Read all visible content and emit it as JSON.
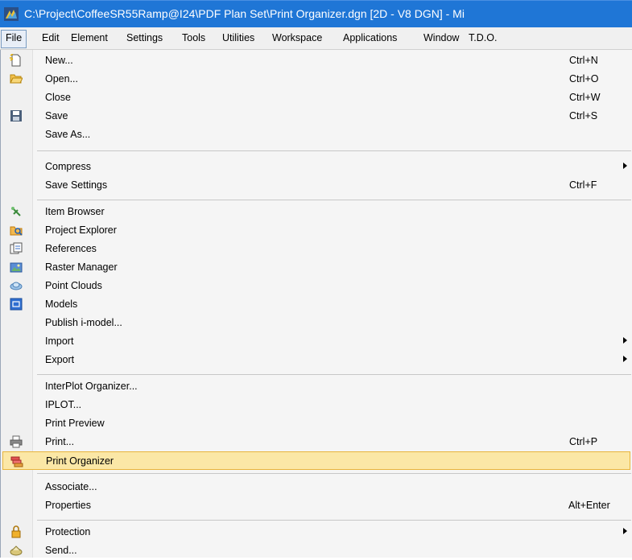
{
  "window": {
    "title": "C:\\Project\\CoffeeSR55Ramp@I24\\PDF Plan Set\\Print Organizer.dgn [2D - V8 DGN] - Mi",
    "app_icon": "microstation-icon"
  },
  "menubar": {
    "items": [
      "File",
      "Edit",
      "Element",
      "Settings",
      "Tools",
      "Utilities",
      "Workspace",
      "Applications",
      "Window",
      "T.D.O."
    ]
  },
  "file_menu": {
    "items": [
      {
        "label": "New...",
        "shortcut": "Ctrl+N",
        "icon": "new-document-icon"
      },
      {
        "label": "Open...",
        "shortcut": "Ctrl+O",
        "icon": "open-folder-icon"
      },
      {
        "label": "Close",
        "shortcut": "Ctrl+W"
      },
      {
        "label": "Save",
        "shortcut": "Ctrl+S",
        "icon": "save-icon"
      },
      {
        "label": "Save As..."
      },
      {
        "label": "Compress",
        "submenu": true
      },
      {
        "label": "Save Settings",
        "shortcut": "Ctrl+F"
      },
      {
        "label": "Item Browser",
        "icon": "item-browser-icon"
      },
      {
        "label": "Project Explorer",
        "icon": "project-explorer-icon"
      },
      {
        "label": "References",
        "icon": "references-icon"
      },
      {
        "label": "Raster Manager",
        "icon": "raster-manager-icon"
      },
      {
        "label": "Point Clouds",
        "icon": "point-clouds-icon"
      },
      {
        "label": "Models",
        "icon": "models-icon"
      },
      {
        "label": "Publish i-model..."
      },
      {
        "label": "Import",
        "submenu": true
      },
      {
        "label": "Export",
        "submenu": true
      },
      {
        "label": "InterPlot Organizer..."
      },
      {
        "label": "IPLOT..."
      },
      {
        "label": "Print Preview"
      },
      {
        "label": "Print...",
        "shortcut": "Ctrl+P",
        "icon": "printer-icon"
      },
      {
        "label": "Print Organizer",
        "icon": "print-organizer-icon",
        "highlighted": true
      },
      {
        "label": "Associate..."
      },
      {
        "label": "Properties",
        "shortcut": "Alt+Enter"
      },
      {
        "label": "Protection",
        "submenu": true,
        "icon": "protection-icon"
      },
      {
        "label": "Send...",
        "icon": "send-icon"
      }
    ]
  }
}
